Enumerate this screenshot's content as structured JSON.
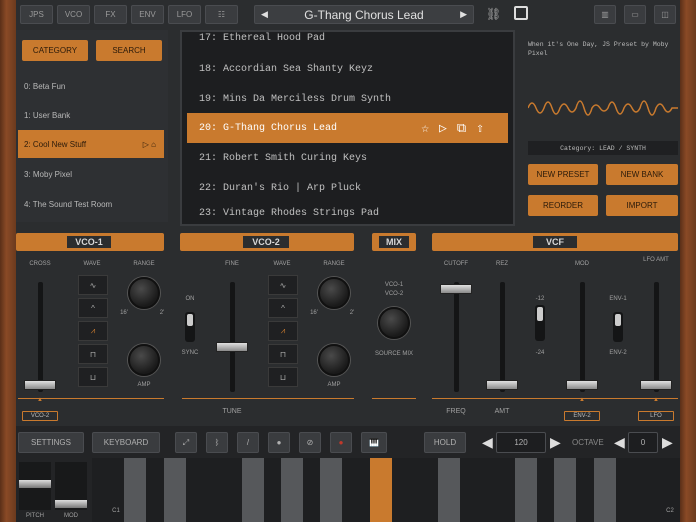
{
  "toolbar": {
    "tabs": [
      "JPS",
      "VCO",
      "FX",
      "ENV",
      "LFO"
    ],
    "preset_name": "G-Thang Chorus Lead"
  },
  "browser": {
    "category_label": "CATEGORY",
    "search_label": "SEARCH",
    "banks": [
      "0: Beta Fun",
      "1: User Bank",
      "2: Cool New Stuff",
      "3: Moby Pixel",
      "4: The Sound Test Room"
    ],
    "presets": [
      "17: Ethereal Hood Pad",
      "18: Accordian Sea Shanty Keyz",
      "19: Mins Da Merciless Drum Synth",
      "20: G-Thang Chorus Lead",
      "21: Robert Smith Curing Keys",
      "22: Duran's Rio | Arp Pluck",
      "23: Vintage Rhodes Strings Pad"
    ]
  },
  "info": {
    "description": "When it's One Day, JS Preset by Moby Pixel",
    "category": "Category: LEAD / SYNTH",
    "new_preset": "NEW PRESET",
    "new_bank": "NEW BANK",
    "reorder": "REORDER",
    "import": "IMPORT"
  },
  "vco1": {
    "title": "VCO-1",
    "cross": "CROSS",
    "wave": "WAVE",
    "range": "RANGE",
    "amp": "AMP",
    "mod_src": "VCO-2",
    "r16": "16'",
    "r2": "2'"
  },
  "vco2": {
    "title": "VCO-2",
    "fine": "FINE",
    "on": "ON",
    "sync": "SYNC",
    "wave": "WAVE",
    "range": "RANGE",
    "amp": "AMP",
    "tune": "TUNE",
    "r16": "16'",
    "r2": "2'"
  },
  "mix": {
    "title": "MIX",
    "src1": "VCO-1",
    "src2": "VCO-2",
    "source_mix": "SOURCE MIX"
  },
  "vcf": {
    "title": "VCF",
    "cutoff": "CUTOFF",
    "rez": "REZ",
    "mod": "MOD",
    "lfo_amt": "LFO AMT",
    "freq": "FREQ",
    "amt": "AMT",
    "n12": "-12",
    "n24": "-24",
    "env1": "ENV-1",
    "env2": "ENV-2",
    "mod_src": "ENV-2",
    "lfo_src": "LFO"
  },
  "bottom": {
    "settings": "SETTINGS",
    "keyboard": "KEYBOARD",
    "hold": "HOLD",
    "tempo": "120",
    "octave_label": "OCTAVE",
    "octave": "0",
    "pitch": "PITCH",
    "mod": "MOD",
    "c1": "C1",
    "c2": "C2"
  },
  "colors": {
    "accent": "#c97a2e",
    "bg": "#2b2d2f"
  }
}
